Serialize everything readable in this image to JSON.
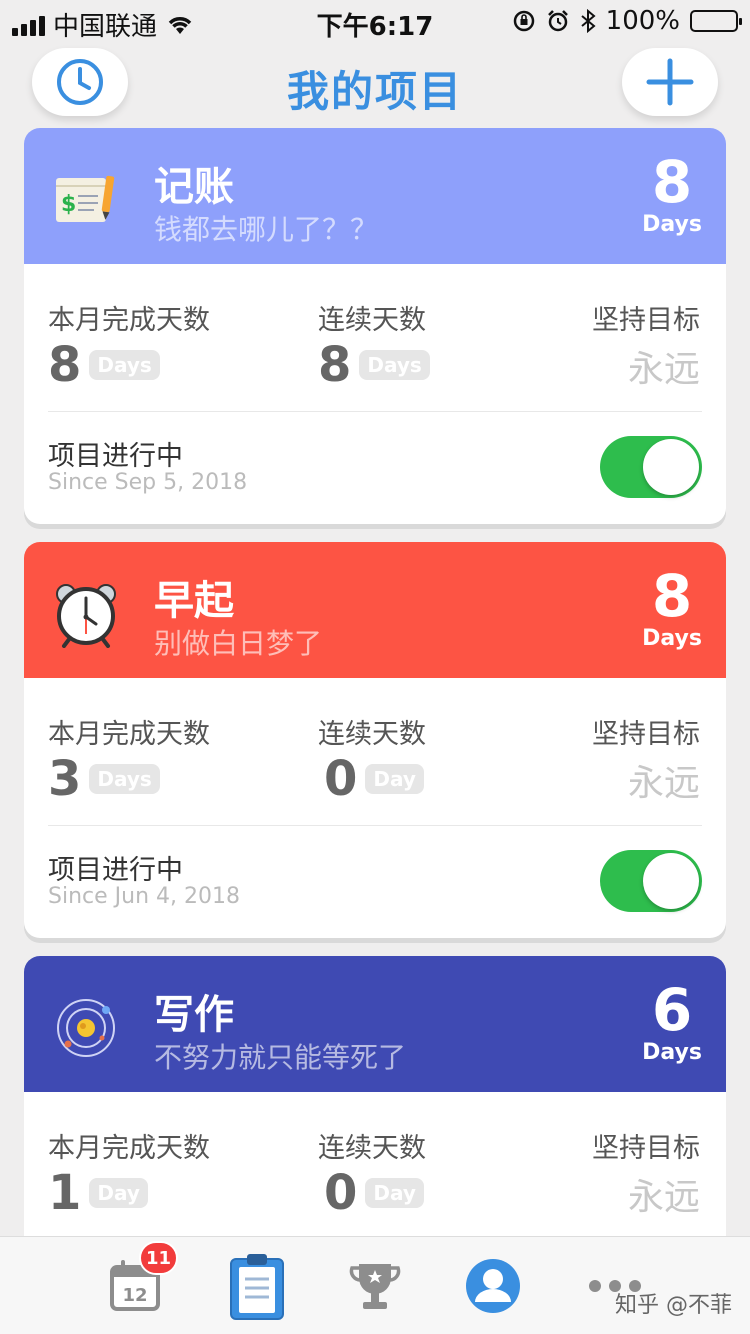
{
  "status_bar": {
    "carrier": "中国联通",
    "time": "下午6:17",
    "battery": "100%"
  },
  "header": {
    "title": "我的项目",
    "left_icon": "clock-icon",
    "right_icon": "plus-icon"
  },
  "colors": {
    "accent": "#3a8fe0",
    "card1": "#8ea0fb",
    "card2": "#fd5444",
    "card3": "#3f4ab3",
    "toggle_on": "#2ebd4d"
  },
  "projects": [
    {
      "name": "记账",
      "motto": "钱都去哪儿了？？",
      "days": "8",
      "days_unit": "Days",
      "icon": "ledger-icon",
      "month_label": "本月完成天数",
      "month_value": "8",
      "month_unit": "Days",
      "streak_label": "连续天数",
      "streak_value": "8",
      "streak_unit": "Days",
      "goal_label": "坚持目标",
      "goal_value": "永远",
      "status": "项目进行中",
      "since": "Since Sep 5, 2018",
      "active": true
    },
    {
      "name": "早起",
      "motto": "别做白日梦了",
      "days": "8",
      "days_unit": "Days",
      "icon": "alarm-clock-icon",
      "month_label": "本月完成天数",
      "month_value": "3",
      "month_unit": "Days",
      "streak_label": "连续天数",
      "streak_value": "0",
      "streak_unit": "Day",
      "goal_label": "坚持目标",
      "goal_value": "永远",
      "status": "项目进行中",
      "since": "Since Jun 4, 2018",
      "active": true
    },
    {
      "name": "写作",
      "motto": "不努力就只能等死了",
      "days": "6",
      "days_unit": "Days",
      "icon": "planet-icon",
      "month_label": "本月完成天数",
      "month_value": "1",
      "month_unit": "Day",
      "streak_label": "连续天数",
      "streak_value": "0",
      "streak_unit": "Day",
      "goal_label": "坚持目标",
      "goal_value": "永远"
    }
  ],
  "tabbar": {
    "calendar_day": "12",
    "calendar_badge": "11",
    "items": [
      "calendar-icon",
      "clipboard-icon",
      "trophy-icon",
      "profile-icon",
      "more-icon"
    ]
  },
  "watermark": "知乎 @不菲"
}
